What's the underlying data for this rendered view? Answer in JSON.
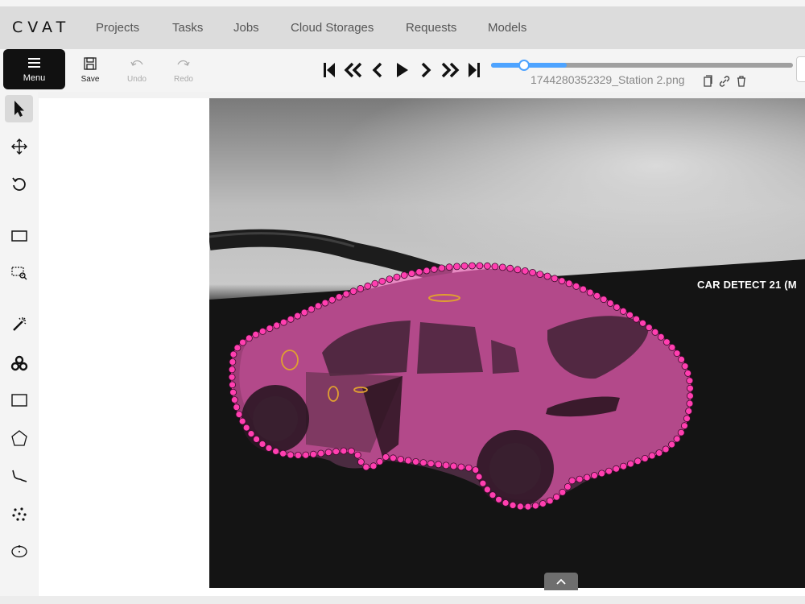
{
  "app": {
    "logo": "CVAT"
  },
  "nav": {
    "items": [
      "Projects",
      "Tasks",
      "Jobs",
      "Cloud Storages",
      "Requests",
      "Models"
    ]
  },
  "toolbar": {
    "menu_label": "Menu",
    "save_label": "Save",
    "undo_label": "Undo",
    "redo_label": "Redo",
    "frame_progress": 0.25,
    "filename": "1744280352329_Station 2.png"
  },
  "sidebar": {
    "tools": [
      "cursor-icon",
      "move-icon",
      "rotate-icon",
      "fit-image-icon",
      "zoom-region-icon",
      "magic-wand-icon",
      "openvino-icon",
      "rectangle-icon",
      "polygon-icon",
      "polyline-icon",
      "points-icon",
      "ellipse-icon"
    ],
    "more": "....."
  },
  "canvas": {
    "object_label": "CAR DETECT 21 (M",
    "polygon_color": "#ff3fb0"
  },
  "colors": {
    "accent": "#4da3ff",
    "annotation": "#ff3fb0"
  }
}
